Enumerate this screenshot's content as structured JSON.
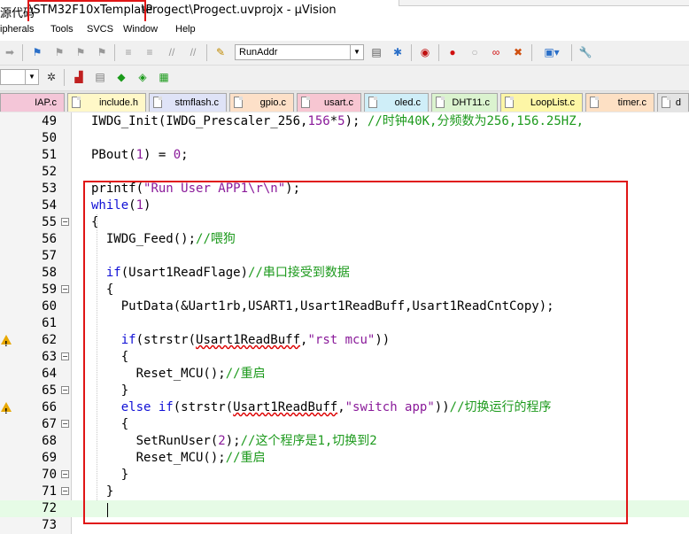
{
  "window": {
    "title_prefix": "源代码",
    "title_folder": "\\STM32F10xTemplate",
    "title_rest": "\\Progect\\Progect.uvprojx - µVision"
  },
  "menu": {
    "items": [
      {
        "label": "ipherals"
      },
      {
        "label": "Tools"
      },
      {
        "label": "SVCS"
      },
      {
        "label": "Window"
      },
      {
        "label": "Help"
      }
    ]
  },
  "toolbar": {
    "target_value": "RunAddr"
  },
  "tabs": [
    {
      "label": "IAP.c",
      "color": "#f4c6d8"
    },
    {
      "label": "include.h",
      "color": "#fff8c8"
    },
    {
      "label": "stmflash.c",
      "color": "#dfe3f7"
    },
    {
      "label": "gpio.c",
      "color": "#fde0c8"
    },
    {
      "label": "usart.c",
      "color": "#f7c6d2"
    },
    {
      "label": "oled.c",
      "color": "#cfeef8"
    },
    {
      "label": "DHT11.c",
      "color": "#dbf3cf"
    },
    {
      "label": "LoopList.c",
      "color": "#fdf6a6"
    },
    {
      "label": "timer.c",
      "color": "#fde0c4"
    },
    {
      "label": "d",
      "color": "#e4e4e4"
    }
  ],
  "editor": {
    "lines": [
      {
        "num": "49",
        "tokens": [
          {
            "t": "IWDG_Init(IWDG_Prescaler_256,"
          },
          {
            "t": "156",
            "c": "nm"
          },
          {
            "t": "*"
          },
          {
            "t": "5",
            "c": "nm"
          },
          {
            "t": "); "
          },
          {
            "t": "//时钟40K,分频数为256,156.25HZ,",
            "c": "cm"
          }
        ]
      },
      {
        "num": "50",
        "tokens": []
      },
      {
        "num": "51",
        "tokens": [
          {
            "t": "PBout("
          },
          {
            "t": "1",
            "c": "nm"
          },
          {
            "t": ") = "
          },
          {
            "t": "0",
            "c": "nm"
          },
          {
            "t": ";"
          }
        ]
      },
      {
        "num": "52",
        "tokens": []
      },
      {
        "num": "53",
        "tokens": [
          {
            "t": "printf("
          },
          {
            "t": "\"Run User APP1\\r\\n\"",
            "c": "st"
          },
          {
            "t": ");"
          }
        ]
      },
      {
        "num": "54",
        "tokens": [
          {
            "t": "while",
            "c": "kw"
          },
          {
            "t": "("
          },
          {
            "t": "1",
            "c": "nm"
          },
          {
            "t": ")"
          }
        ]
      },
      {
        "num": "55",
        "fold": "−",
        "tokens": [
          {
            "t": "{"
          }
        ]
      },
      {
        "num": "56",
        "tokens": [
          {
            "t": "  IWDG_Feed();"
          },
          {
            "t": "//喂狗",
            "c": "cm"
          }
        ]
      },
      {
        "num": "57",
        "tokens": []
      },
      {
        "num": "58",
        "tokens": [
          {
            "t": "  "
          },
          {
            "t": "if",
            "c": "kw"
          },
          {
            "t": "(Usart1ReadFlage)"
          },
          {
            "t": "//串口接受到数据",
            "c": "cm"
          }
        ]
      },
      {
        "num": "59",
        "fold": "−",
        "tokens": [
          {
            "t": "  {"
          }
        ]
      },
      {
        "num": "60",
        "tokens": [
          {
            "t": "    PutData(&Uart1rb,USART1,Usart1ReadBuff,Usart1ReadCntCopy);"
          }
        ]
      },
      {
        "num": "61",
        "tokens": []
      },
      {
        "num": "62",
        "warn": true,
        "tokens": [
          {
            "t": "    "
          },
          {
            "t": "if",
            "c": "kw"
          },
          {
            "t": "(strstr("
          },
          {
            "t": "Usart1ReadBuff",
            "sq": true
          },
          {
            "t": ","
          },
          {
            "t": "\"rst mcu\"",
            "c": "st"
          },
          {
            "t": "))"
          }
        ]
      },
      {
        "num": "63",
        "fold": "−",
        "tokens": [
          {
            "t": "    {"
          }
        ]
      },
      {
        "num": "64",
        "tokens": [
          {
            "t": "      Reset_MCU();"
          },
          {
            "t": "//重启",
            "c": "cm"
          }
        ]
      },
      {
        "num": "65",
        "fold": "−",
        "tokens": [
          {
            "t": "    }"
          }
        ]
      },
      {
        "num": "66",
        "warn": true,
        "tokens": [
          {
            "t": "    "
          },
          {
            "t": "else if",
            "c": "kw"
          },
          {
            "t": "(strstr("
          },
          {
            "t": "Usart1ReadBuff",
            "sq": true
          },
          {
            "t": ","
          },
          {
            "t": "\"switch app\"",
            "c": "st"
          },
          {
            "t": "))"
          },
          {
            "t": "//切换运行的程序",
            "c": "cm"
          }
        ]
      },
      {
        "num": "67",
        "fold": "−",
        "tokens": [
          {
            "t": "    {"
          }
        ]
      },
      {
        "num": "68",
        "tokens": [
          {
            "t": "      SetRunUser("
          },
          {
            "t": "2",
            "c": "nm"
          },
          {
            "t": ");"
          },
          {
            "t": "//这个程序是1,切换到2",
            "c": "cm"
          }
        ]
      },
      {
        "num": "69",
        "tokens": [
          {
            "t": "      Reset_MCU();"
          },
          {
            "t": "//重启",
            "c": "cm"
          }
        ]
      },
      {
        "num": "70",
        "fold": "−",
        "tokens": [
          {
            "t": "    }"
          }
        ]
      },
      {
        "num": "71",
        "fold": "−",
        "tokens": [
          {
            "t": "  }"
          }
        ]
      },
      {
        "num": "72",
        "current": true,
        "tokens": []
      },
      {
        "num": "73",
        "tokens": []
      }
    ]
  }
}
